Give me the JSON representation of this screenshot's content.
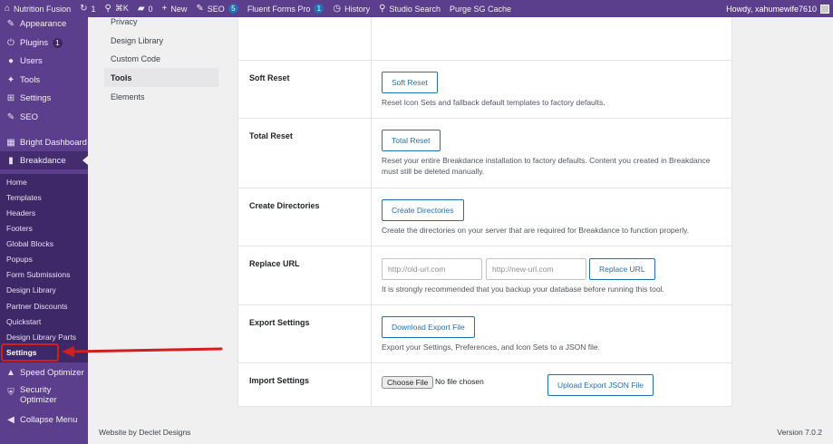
{
  "adminbar": {
    "site_name": "Nutrition Fusion",
    "updates_count": "1",
    "cmdk": "⌘K",
    "comments_count": "0",
    "new_label": "New",
    "seo_label": "SEO",
    "seo_count": "5",
    "fluent_label": "Fluent Forms Pro",
    "fluent_count": "1",
    "history_label": "History",
    "studio_label": "Studio Search",
    "purge_label": "Purge SG Cache",
    "howdy": "Howdy, xahumewife7610"
  },
  "sidebar": {
    "appearance": "Appearance",
    "plugins": "Plugins",
    "plugins_count": "1",
    "users": "Users",
    "tools": "Tools",
    "settings": "Settings",
    "seo": "SEO",
    "bright_dashboard": "Bright Dashboard",
    "breakdance": "Breakdance",
    "submenu": [
      "Home",
      "Templates",
      "Headers",
      "Footers",
      "Global Blocks",
      "Popups",
      "Form Submissions",
      "Design Library",
      "Partner Discounts",
      "Quickstart",
      "Design Library Parts",
      "Settings"
    ],
    "speed_optimizer": "Speed Optimizer",
    "security_optimizer_1": "Security",
    "security_optimizer_2": "Optimizer",
    "collapse": "Collapse Menu"
  },
  "secnav": {
    "items": [
      "Privacy",
      "Design Library",
      "Custom Code",
      "Tools",
      "Elements"
    ]
  },
  "rows": {
    "soft_reset": {
      "label": "Soft Reset",
      "button": "Soft Reset",
      "desc": "Reset Icon Sets and fallback default templates to factory defaults."
    },
    "total_reset": {
      "label": "Total Reset",
      "button": "Total Reset",
      "desc": "Reset your entire Breakdance installation to factory defaults. Content you created in Breakdance must still be deleted manually."
    },
    "create_dirs": {
      "label": "Create Directories",
      "button": "Create Directories",
      "desc": "Create the directories on your server that are required for Breakdance to function properly."
    },
    "replace_url": {
      "label": "Replace URL",
      "old_placeholder": "http://old-url.com",
      "new_placeholder": "http://new-url.com",
      "button": "Replace URL",
      "desc": "It is strongly recommended that you backup your database before running this tool."
    },
    "export": {
      "label": "Export Settings",
      "button": "Download Export File",
      "desc": "Export your Settings, Preferences, and Icon Sets to a JSON file."
    },
    "import": {
      "label": "Import Settings",
      "choose": "Choose File",
      "no_file": "No file chosen",
      "button": "Upload Export JSON File"
    }
  },
  "footer": {
    "left": "Website by Declet Designs",
    "right": "Version 7.0.2"
  },
  "colors": {
    "sidebar": "#5b3f8c",
    "accent": "#2271b1",
    "highlight": "#d31e1e"
  }
}
